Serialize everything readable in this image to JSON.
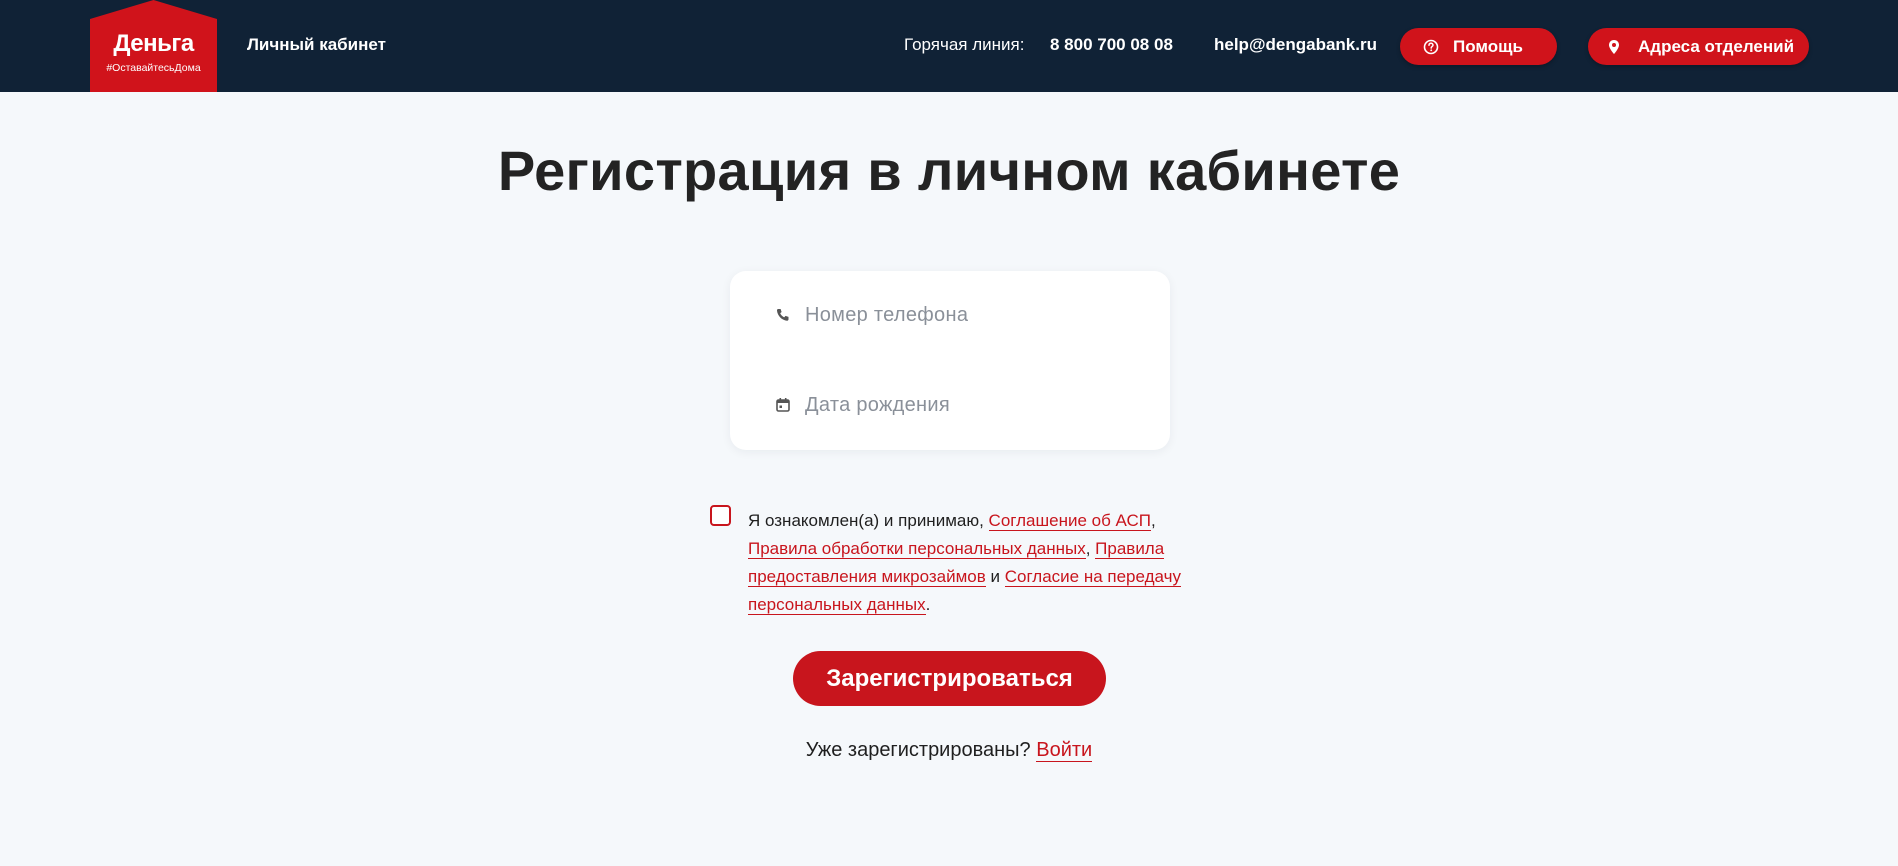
{
  "header": {
    "logo_name": "Деньга",
    "logo_tagline": "#ОставайтесьДома",
    "cabinet_link": "Личный кабинет",
    "hotline_label": "Горячая линия:",
    "hotline_phone": "8 800 700 08 08",
    "email": "help@dengabank.ru",
    "help_button": "Помощь",
    "addresses_button": "Адреса отделений"
  },
  "main": {
    "title": "Регистрация в личном кабинете",
    "phone_field": {
      "placeholder": "Номер телефона",
      "value": ""
    },
    "birthdate_field": {
      "placeholder": "Дата рождения",
      "value": ""
    },
    "consent": {
      "checked": false,
      "intro": "Я ознакомлен(а) и принимаю, ",
      "link_asp": "Соглашение об АСП",
      "sep1": ", ",
      "link_personal_data": "Правила обработки персональных данных",
      "sep2": ", ",
      "link_microloans": "Правила предоставления микрозаймов",
      "sep3": " и ",
      "link_transfer": "Согласие на передачу персональных данных",
      "end": "."
    },
    "register_button": "Зарегистрироваться",
    "already_registered": "Уже зарегистрированы? ",
    "login_link": "Войти"
  },
  "colors": {
    "header_bg": "#102236",
    "accent_red": "#c8151d",
    "page_bg": "#f5f8fb"
  },
  "icons": {
    "help": "question-circle-icon",
    "addresses": "map-pin-icon",
    "phone_field": "phone-icon",
    "birthdate_field": "calendar-icon"
  }
}
